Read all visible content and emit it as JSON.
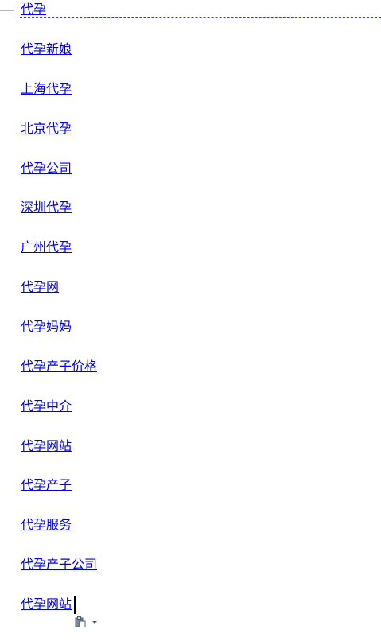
{
  "document": {
    "links": [
      {
        "text": "代孕"
      },
      {
        "text": "代孕新娘"
      },
      {
        "text": "上海代孕"
      },
      {
        "text": "北京代孕"
      },
      {
        "text": "代孕公司"
      },
      {
        "text": "深圳代孕"
      },
      {
        "text": "广州代孕"
      },
      {
        "text": "代孕网"
      },
      {
        "text": "代孕妈妈"
      },
      {
        "text": "代孕产子价格"
      },
      {
        "text": "代孕中介"
      },
      {
        "text": "代孕网站"
      },
      {
        "text": "代孕产子"
      },
      {
        "text": "代孕服务"
      },
      {
        "text": "代孕产子公司"
      },
      {
        "text": "代孕网站"
      }
    ]
  },
  "colors": {
    "link": "#0000ee",
    "dashed_line": "#3a3ad0",
    "background": "#ffffff"
  },
  "icons": {
    "paste_options": "clipboard-icon",
    "paste_dropdown": "chevron-down-icon"
  }
}
